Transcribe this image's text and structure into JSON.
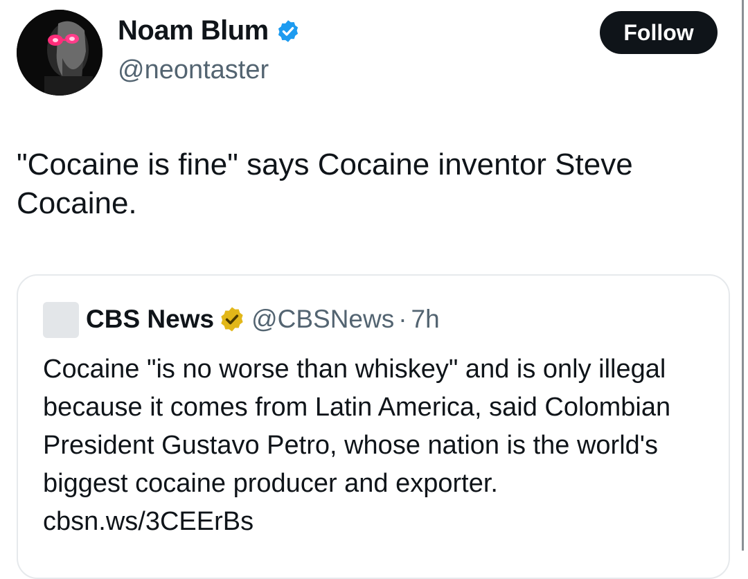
{
  "author": {
    "name": "Noam Blum",
    "handle": "@neontaster",
    "verified_color": "#1d9bf0"
  },
  "follow_label": "Follow",
  "tweet_text": "\"Cocaine is fine\" says Cocaine inventor Steve Cocaine.",
  "quote": {
    "name": "CBS News",
    "handle": "@CBSNews",
    "separator": "·",
    "time": "7h",
    "verified_color": "#e2b719",
    "text": "Cocaine \"is no worse than whiskey\" and is only illegal because it comes from Latin America, said Colombian President Gustavo Petro, whose nation is the world's biggest cocaine producer and exporter. cbsn.ws/3CEErBs"
  }
}
